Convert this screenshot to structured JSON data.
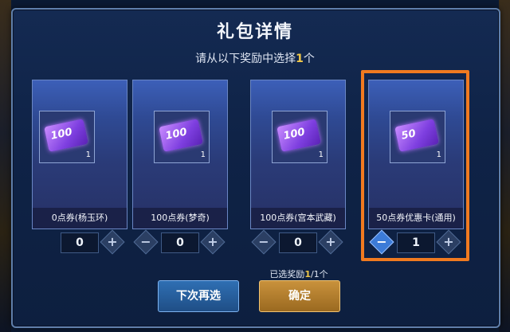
{
  "dialog": {
    "title": "礼包详情",
    "subtitle_prefix": "请从以下奖励中选择",
    "subtitle_count": "1",
    "subtitle_suffix": "个"
  },
  "cards": [
    {
      "ticket_label": "100",
      "qty": "1",
      "name": "0点券(杨玉环)",
      "value": "0",
      "minus": "−",
      "plus": "+"
    },
    {
      "ticket_label": "100",
      "qty": "1",
      "name": "100点券(梦奇)",
      "value": "0",
      "minus": "−",
      "plus": "+"
    },
    {
      "ticket_label": "100",
      "qty": "1",
      "name": "100点券(宫本武藏)",
      "value": "0",
      "minus": "−",
      "plus": "+"
    },
    {
      "ticket_label": "50",
      "qty": "1",
      "name": "50点券优惠卡(通用)",
      "value": "1",
      "minus": "−",
      "plus": "+"
    }
  ],
  "selected": {
    "prefix": "已选奖励",
    "count": "1",
    "total": "/1个"
  },
  "buttons": {
    "later": "下次再选",
    "confirm": "确定"
  },
  "colors": {
    "highlight": "#f07a20",
    "accent": "#f0c84a"
  },
  "icons": {
    "ticket": "voucher-ticket-icon",
    "minus": "minus-icon",
    "plus": "plus-icon"
  }
}
